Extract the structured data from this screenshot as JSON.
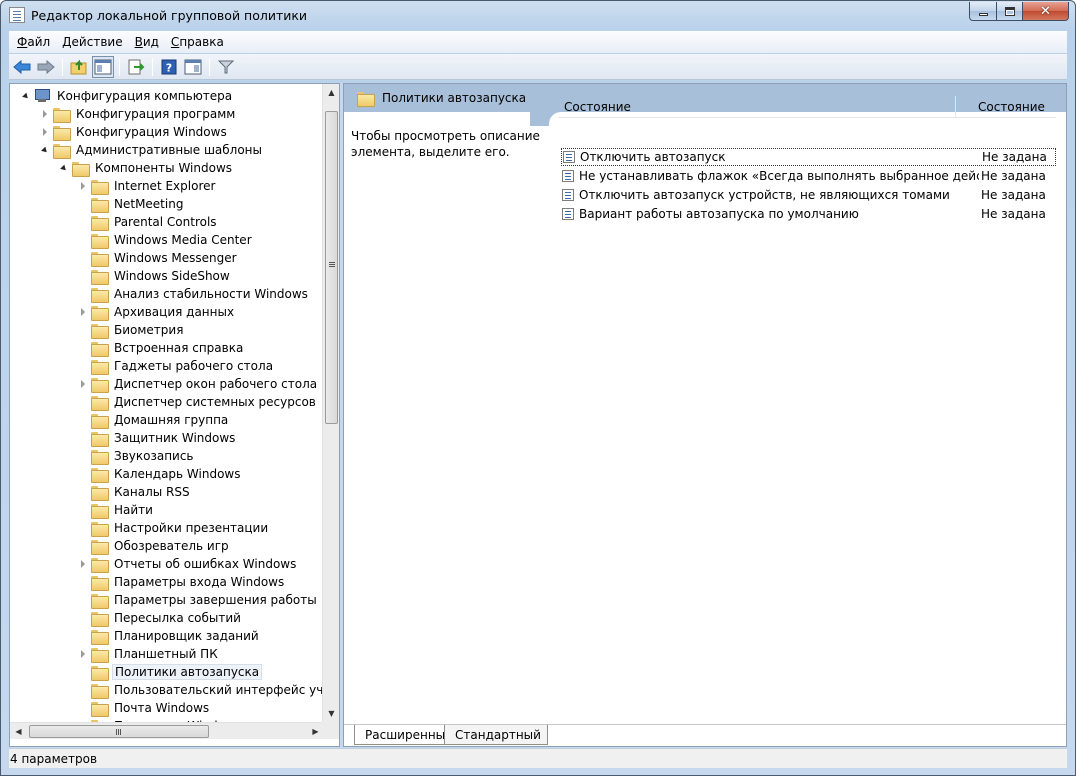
{
  "window": {
    "title": "Редактор локальной групповой политики"
  },
  "menu": {
    "items": [
      {
        "mnemonic": "Ф",
        "rest": "айл"
      },
      {
        "mnemonic": "Д",
        "rest": "ействие"
      },
      {
        "mnemonic": "В",
        "rest": "ид"
      },
      {
        "mnemonic": "С",
        "rest": "правка"
      }
    ]
  },
  "toolbar": {
    "buttons": [
      "back-arrow-icon",
      "forward-arrow-icon",
      "up-folder-icon",
      "show-hide-tree-icon",
      "export-list-icon",
      "help-icon",
      "show-hide-action-pane-icon",
      "filter-icon"
    ]
  },
  "tree": {
    "items": [
      {
        "label": "Конфигурация компьютера",
        "level": 0,
        "expander": "expanded",
        "icon": "computer-icon"
      },
      {
        "label": "Конфигурация программ",
        "level": 1,
        "expander": "collapsed"
      },
      {
        "label": "Конфигурация Windows",
        "level": 1,
        "expander": "collapsed"
      },
      {
        "label": "Административные шаблоны",
        "level": 1,
        "expander": "expanded"
      },
      {
        "label": "Компоненты Windows",
        "level": 2,
        "expander": "expanded"
      },
      {
        "label": "Internet Explorer",
        "level": 3,
        "expander": "collapsed"
      },
      {
        "label": "NetMeeting",
        "level": 3,
        "expander": "none"
      },
      {
        "label": "Parental Controls",
        "level": 3,
        "expander": "none"
      },
      {
        "label": "Windows Media Center",
        "level": 3,
        "expander": "none"
      },
      {
        "label": "Windows Messenger",
        "level": 3,
        "expander": "none"
      },
      {
        "label": "Windows SideShow",
        "level": 3,
        "expander": "none"
      },
      {
        "label": "Анализ стабильности Windows",
        "level": 3,
        "expander": "none"
      },
      {
        "label": "Архивация данных",
        "level": 3,
        "expander": "collapsed"
      },
      {
        "label": "Биометрия",
        "level": 3,
        "expander": "none"
      },
      {
        "label": "Встроенная справка",
        "level": 3,
        "expander": "none"
      },
      {
        "label": "Гаджеты рабочего стола",
        "level": 3,
        "expander": "none"
      },
      {
        "label": "Диспетчер окон рабочего стола",
        "level": 3,
        "expander": "collapsed"
      },
      {
        "label": "Диспетчер системных ресурсов",
        "level": 3,
        "expander": "none"
      },
      {
        "label": "Домашняя группа",
        "level": 3,
        "expander": "none"
      },
      {
        "label": "Защитник Windows",
        "level": 3,
        "expander": "none"
      },
      {
        "label": "Звукозапись",
        "level": 3,
        "expander": "none"
      },
      {
        "label": "Календарь Windows",
        "level": 3,
        "expander": "none"
      },
      {
        "label": "Каналы RSS",
        "level": 3,
        "expander": "none"
      },
      {
        "label": "Найти",
        "level": 3,
        "expander": "none"
      },
      {
        "label": "Настройки презентации",
        "level": 3,
        "expander": "none"
      },
      {
        "label": "Обозреватель игр",
        "level": 3,
        "expander": "none"
      },
      {
        "label": "Отчеты об ошибках Windows",
        "level": 3,
        "expander": "collapsed"
      },
      {
        "label": "Параметры входа Windows",
        "level": 3,
        "expander": "none"
      },
      {
        "label": "Параметры завершения работы",
        "level": 3,
        "expander": "none"
      },
      {
        "label": "Пересылка событий",
        "level": 3,
        "expander": "none"
      },
      {
        "label": "Планировщик заданий",
        "level": 3,
        "expander": "none"
      },
      {
        "label": "Планшетный ПК",
        "level": 3,
        "expander": "collapsed"
      },
      {
        "label": "Политики автозапуска",
        "level": 3,
        "expander": "none",
        "selected": true
      },
      {
        "label": "Пользовательский интерфейс учетных",
        "level": 3,
        "expander": "none"
      },
      {
        "label": "Почта Windows",
        "level": 3,
        "expander": "none"
      },
      {
        "label": "Проводник Windows",
        "level": 3,
        "expander": "collapsed"
      }
    ]
  },
  "right_pane": {
    "header_title": "Политики автозапуска",
    "description": "Чтобы просмотреть описание элемента, выделите его.",
    "columns": [
      "Состояние",
      "Состояние"
    ],
    "rows": [
      {
        "name": "Отключить автозапуск",
        "state": "Не задана",
        "focused": true
      },
      {
        "name": "Не устанавливать флажок «Всегда выполнять выбранное действие»",
        "state": "Не задана"
      },
      {
        "name": "Отключить автозапуск устройств, не являющихся томами",
        "state": "Не задана"
      },
      {
        "name": "Вариант работы автозапуска по умолчанию",
        "state": "Не задана"
      }
    ],
    "tabs": [
      "Расширенный",
      "Стандартный"
    ]
  },
  "status": {
    "text": "4 параметров"
  }
}
